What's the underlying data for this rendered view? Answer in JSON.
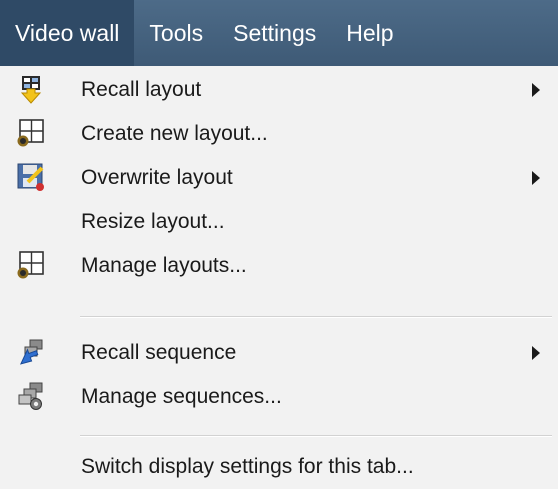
{
  "menubar": {
    "items": [
      {
        "label": "Video wall",
        "active": true
      },
      {
        "label": "Tools"
      },
      {
        "label": "Settings"
      },
      {
        "label": "Help"
      }
    ]
  },
  "menu": {
    "items": [
      {
        "label": "Recall layout",
        "icon": "recall-layout-icon",
        "submenu": true
      },
      {
        "label": "Create new layout...",
        "icon": "create-layout-icon",
        "submenu": false
      },
      {
        "label": "Overwrite layout",
        "icon": "save-overwrite-icon",
        "submenu": true
      },
      {
        "label": "Resize layout...",
        "icon": "",
        "submenu": false
      },
      {
        "label": "Manage layouts...",
        "icon": "manage-layouts-icon",
        "submenu": false
      },
      {
        "label": "Recall sequence",
        "icon": "recall-sequence-icon",
        "submenu": true
      },
      {
        "label": "Manage sequences...",
        "icon": "manage-sequences-icon",
        "submenu": false
      },
      {
        "label": "Switch display settings for this tab...",
        "icon": "",
        "submenu": false
      }
    ]
  },
  "colors": {
    "menubar_bg": "#46627f",
    "menubar_active": "#2f4a66",
    "menu_bg": "#f2f2f2",
    "text": "#1a1a1a"
  }
}
